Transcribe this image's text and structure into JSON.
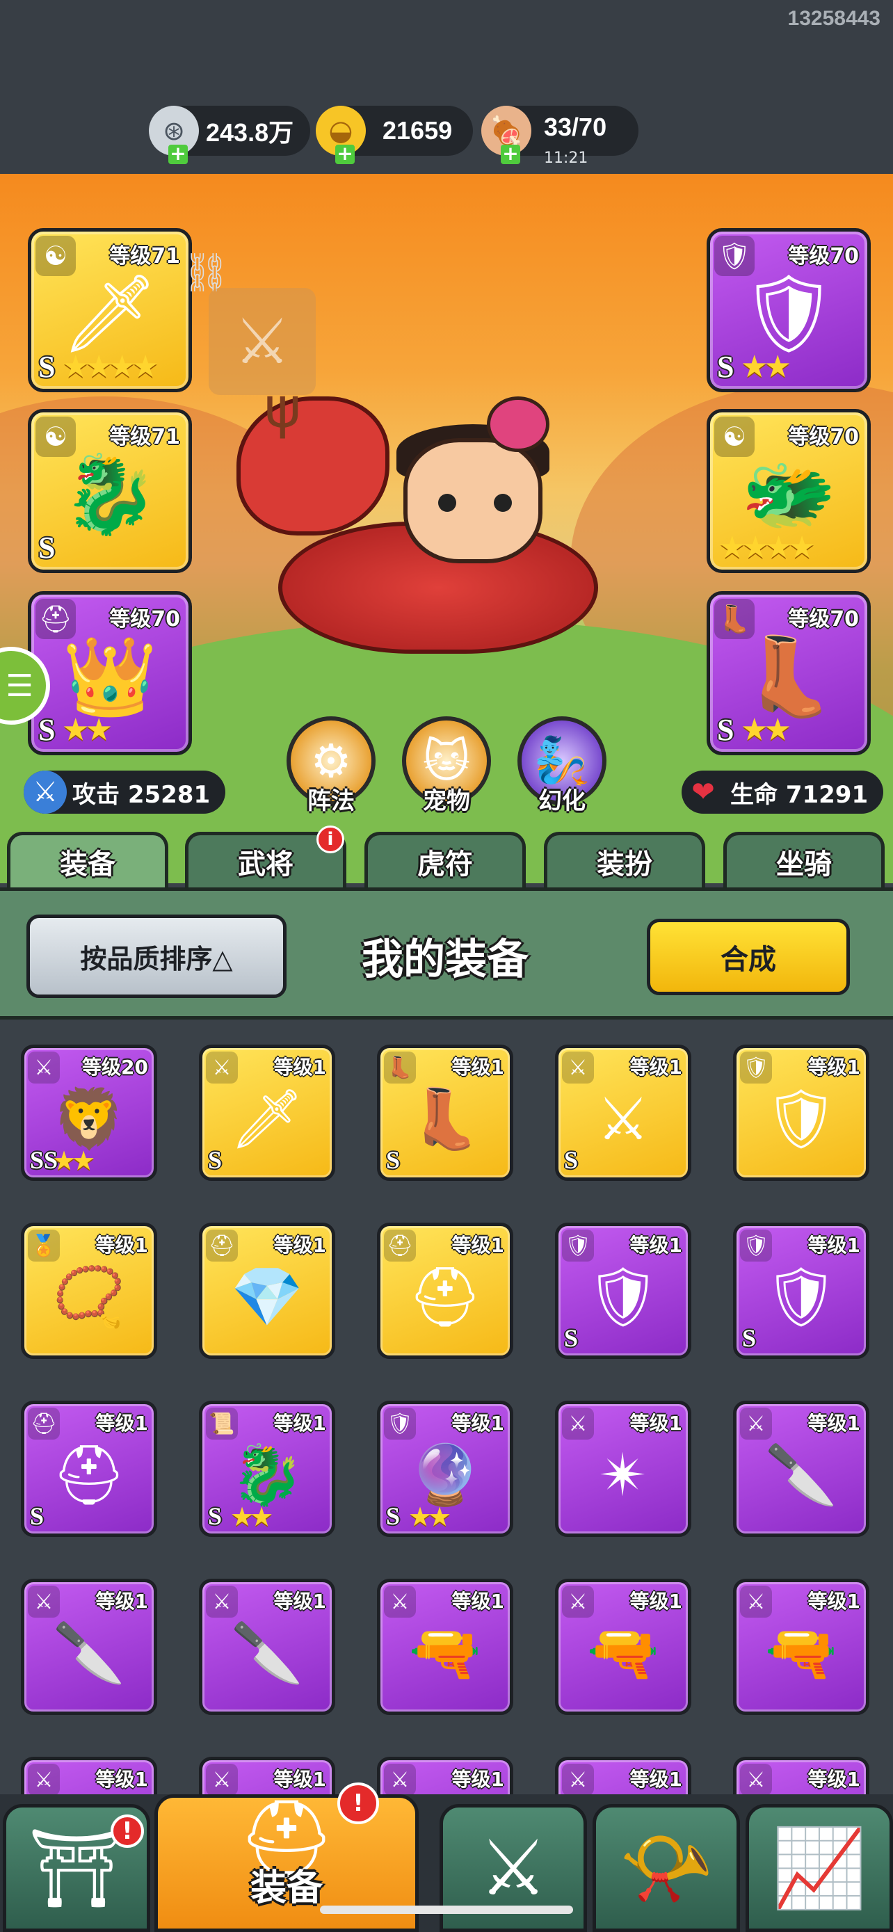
{
  "user_id": "13258443",
  "resources": [
    {
      "icon": "silver-coin-icon",
      "value": "243.8万",
      "sub": ""
    },
    {
      "icon": "gold-ingot-icon",
      "value": "21659",
      "sub": ""
    },
    {
      "icon": "meat-stamina-icon",
      "value": "33/70",
      "sub": "11:21"
    }
  ],
  "equipped": {
    "left": [
      {
        "slot": "weapon",
        "badge": "yin-yang-icon",
        "level": "等级71",
        "grade": "S",
        "stars": "★★★★",
        "color": "gold",
        "art": "🗡"
      },
      {
        "slot": "accessory",
        "badge": "yin-yang-icon",
        "level": "等级71",
        "grade": "S",
        "stars": "",
        "color": "gold",
        "art": "🐉"
      },
      {
        "slot": "helmet",
        "badge": "helmet-icon",
        "level": "等级70",
        "grade": "S",
        "stars": "★★",
        "color": "purple",
        "art": "👑"
      }
    ],
    "right": [
      {
        "slot": "armor",
        "badge": "armor-icon",
        "level": "等级70",
        "grade": "S",
        "stars": "★★",
        "color": "purple",
        "art": "🛡"
      },
      {
        "slot": "accessory",
        "badge": "yin-yang-icon",
        "level": "等级70",
        "grade": "",
        "stars": "★★★★",
        "color": "gold",
        "art": "🐲"
      },
      {
        "slot": "boots",
        "badge": "boot-icon",
        "level": "等级70",
        "grade": "S",
        "stars": "★★",
        "color": "purple",
        "art": "👢"
      }
    ]
  },
  "hero_buttons": [
    {
      "label": "阵法",
      "icon": "formation-icon"
    },
    {
      "label": "宠物",
      "icon": "pet-cat-icon"
    },
    {
      "label": "幻化",
      "icon": "transform-icon"
    }
  ],
  "stats": {
    "attack": "攻击 25281",
    "hp": "生命 71291"
  },
  "tabs": [
    {
      "label": "装备",
      "active": true,
      "alert": ""
    },
    {
      "label": "武将",
      "active": false,
      "alert": "i"
    },
    {
      "label": "虎符",
      "active": false,
      "alert": ""
    },
    {
      "label": "装扮",
      "active": false,
      "alert": ""
    },
    {
      "label": "坐骑",
      "active": false,
      "alert": ""
    }
  ],
  "panel": {
    "sort_label": "按品质排序△",
    "title": "我的装备",
    "merge_label": "合成"
  },
  "inventory": [
    {
      "badge": "sword-icon",
      "level": "等级20",
      "grade": "SS",
      "stars": "★★",
      "color": "purple",
      "art": "🦁"
    },
    {
      "badge": "sword-icon",
      "level": "等级1",
      "grade": "S",
      "stars": "",
      "color": "gold",
      "art": "🗡"
    },
    {
      "badge": "boot-icon",
      "level": "等级1",
      "grade": "S",
      "stars": "",
      "color": "gold",
      "art": "👢"
    },
    {
      "badge": "sword-icon",
      "level": "等级1",
      "grade": "S",
      "stars": "",
      "color": "gold",
      "art": "⚔"
    },
    {
      "badge": "armor-icon",
      "level": "等级1",
      "grade": "",
      "stars": "",
      "color": "gold",
      "art": "🛡"
    },
    {
      "badge": "medal-icon",
      "level": "等级1",
      "grade": "",
      "stars": "",
      "color": "gold",
      "art": "📿"
    },
    {
      "badge": "helmet-icon",
      "level": "等级1",
      "grade": "",
      "stars": "",
      "color": "gold",
      "art": "💎"
    },
    {
      "badge": "helmet-icon",
      "level": "等级1",
      "grade": "",
      "stars": "",
      "color": "gold",
      "art": "⛑"
    },
    {
      "badge": "armor-icon",
      "level": "等级1",
      "grade": "S",
      "stars": "",
      "color": "purple",
      "art": "🛡"
    },
    {
      "badge": "armor-icon",
      "level": "等级1",
      "grade": "S",
      "stars": "",
      "color": "purple",
      "art": "🛡"
    },
    {
      "badge": "helmet-icon",
      "level": "等级1",
      "grade": "S",
      "stars": "",
      "color": "purple",
      "art": "⛑"
    },
    {
      "badge": "scroll-icon",
      "level": "等级1",
      "grade": "S",
      "stars": "★★",
      "color": "purple",
      "art": "🐉"
    },
    {
      "badge": "armor-icon",
      "level": "等级1",
      "grade": "S",
      "stars": "★★",
      "color": "purple",
      "art": "🔮"
    },
    {
      "badge": "sword-icon",
      "level": "等级1",
      "grade": "",
      "stars": "",
      "color": "purple",
      "art": "✴"
    },
    {
      "badge": "sword-icon",
      "level": "等级1",
      "grade": "",
      "stars": "",
      "color": "purple",
      "art": "🔪"
    },
    {
      "badge": "sword-icon",
      "level": "等级1",
      "grade": "",
      "stars": "",
      "color": "purple",
      "art": "🔪"
    },
    {
      "badge": "sword-icon",
      "level": "等级1",
      "grade": "",
      "stars": "",
      "color": "purple",
      "art": "🔪"
    },
    {
      "badge": "sword-icon",
      "level": "等级1",
      "grade": "",
      "stars": "",
      "color": "purple",
      "art": "🔫"
    },
    {
      "badge": "sword-icon",
      "level": "等级1",
      "grade": "",
      "stars": "",
      "color": "purple",
      "art": "🔫"
    },
    {
      "badge": "sword-icon",
      "level": "等级1",
      "grade": "",
      "stars": "",
      "color": "purple",
      "art": "🔫"
    },
    {
      "badge": "sword-icon",
      "level": "等级1",
      "grade": "",
      "stars": "",
      "color": "purple",
      "art": ""
    },
    {
      "badge": "sword-icon",
      "level": "等级1",
      "grade": "",
      "stars": "",
      "color": "purple",
      "art": ""
    },
    {
      "badge": "sword-icon",
      "level": "等级1",
      "grade": "",
      "stars": "",
      "color": "purple",
      "art": ""
    },
    {
      "badge": "sword-icon",
      "level": "等级1",
      "grade": "",
      "stars": "",
      "color": "purple",
      "art": ""
    },
    {
      "badge": "sword-icon",
      "level": "等级1",
      "grade": "",
      "stars": "",
      "color": "purple",
      "art": ""
    }
  ],
  "bottom_nav": [
    {
      "icon": "shop-gate-icon",
      "label": "",
      "alert": "!"
    },
    {
      "icon": "helmet-icon",
      "label": "装备",
      "alert": "!"
    },
    {
      "icon": "crossed-swords-icon",
      "label": "",
      "alert": ""
    },
    {
      "icon": "heroes-horn-icon",
      "label": "",
      "alert": ""
    },
    {
      "icon": "upgrade-icon",
      "label": "",
      "alert": ""
    }
  ]
}
